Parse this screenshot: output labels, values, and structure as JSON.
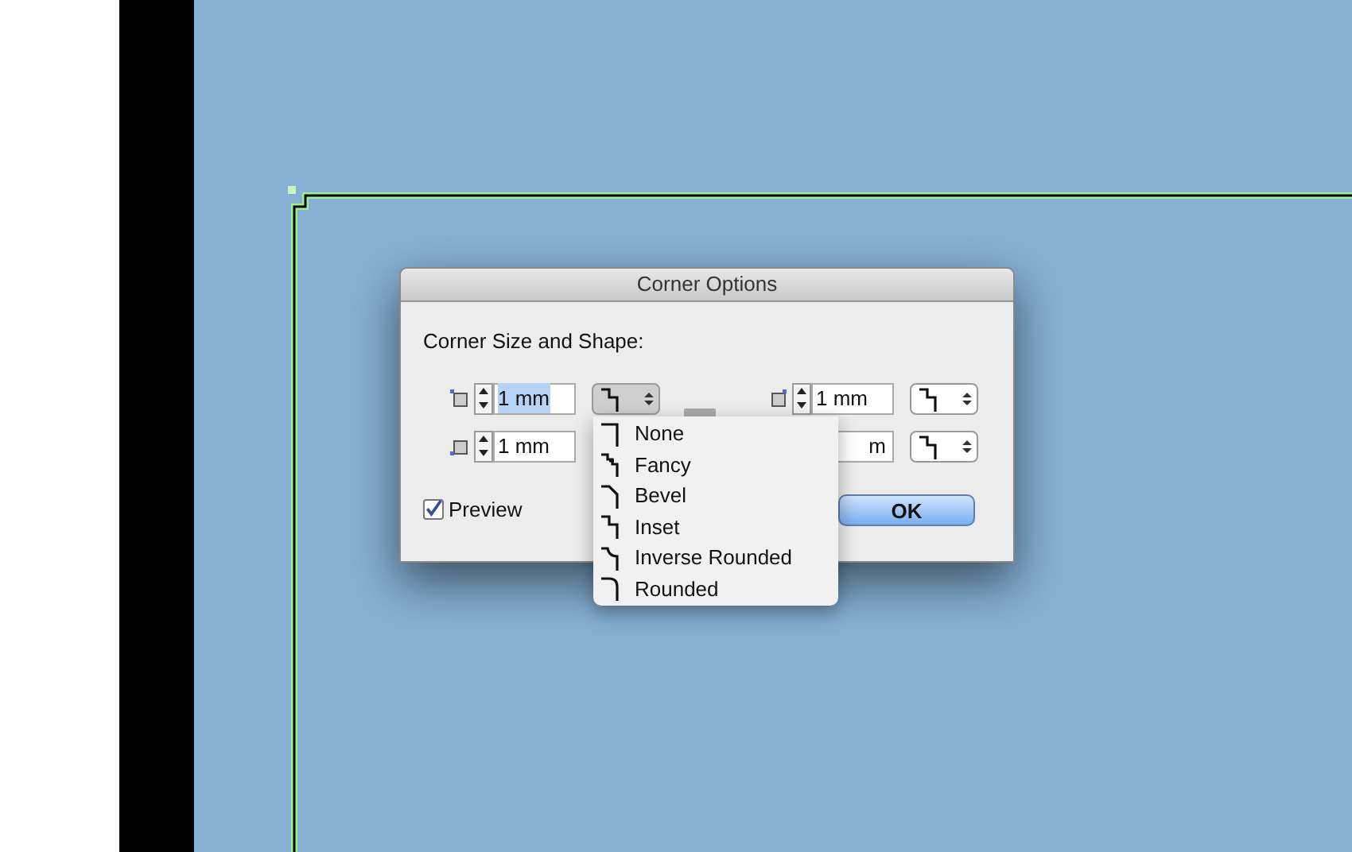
{
  "dialog": {
    "title": "Corner Options",
    "heading": "Corner Size and Shape:",
    "corners": [
      {
        "size": "1 mm",
        "text_selected": true,
        "kind": "inset",
        "menu_open": true,
        "covered": false
      },
      {
        "size": "1 mm",
        "text_selected": false,
        "kind": "inset",
        "menu_open": false,
        "covered": false
      },
      {
        "size": "1 mm",
        "text_selected": false,
        "covered": false
      },
      {
        "size": "m",
        "text_selected": false,
        "kind": "inset",
        "menu_open": false,
        "covered": true
      }
    ],
    "preview": {
      "label": "Preview",
      "checked": true
    },
    "ok_button": "OK",
    "shape_menu": [
      {
        "label": "None",
        "kind": "none"
      },
      {
        "label": "Fancy",
        "kind": "fancy"
      },
      {
        "label": "Bevel",
        "kind": "bevel"
      },
      {
        "label": "Inset",
        "kind": "inset"
      },
      {
        "label": "Inverse Rounded",
        "kind": "inverse_rounded"
      },
      {
        "label": "Rounded",
        "kind": "rounded"
      }
    ]
  }
}
